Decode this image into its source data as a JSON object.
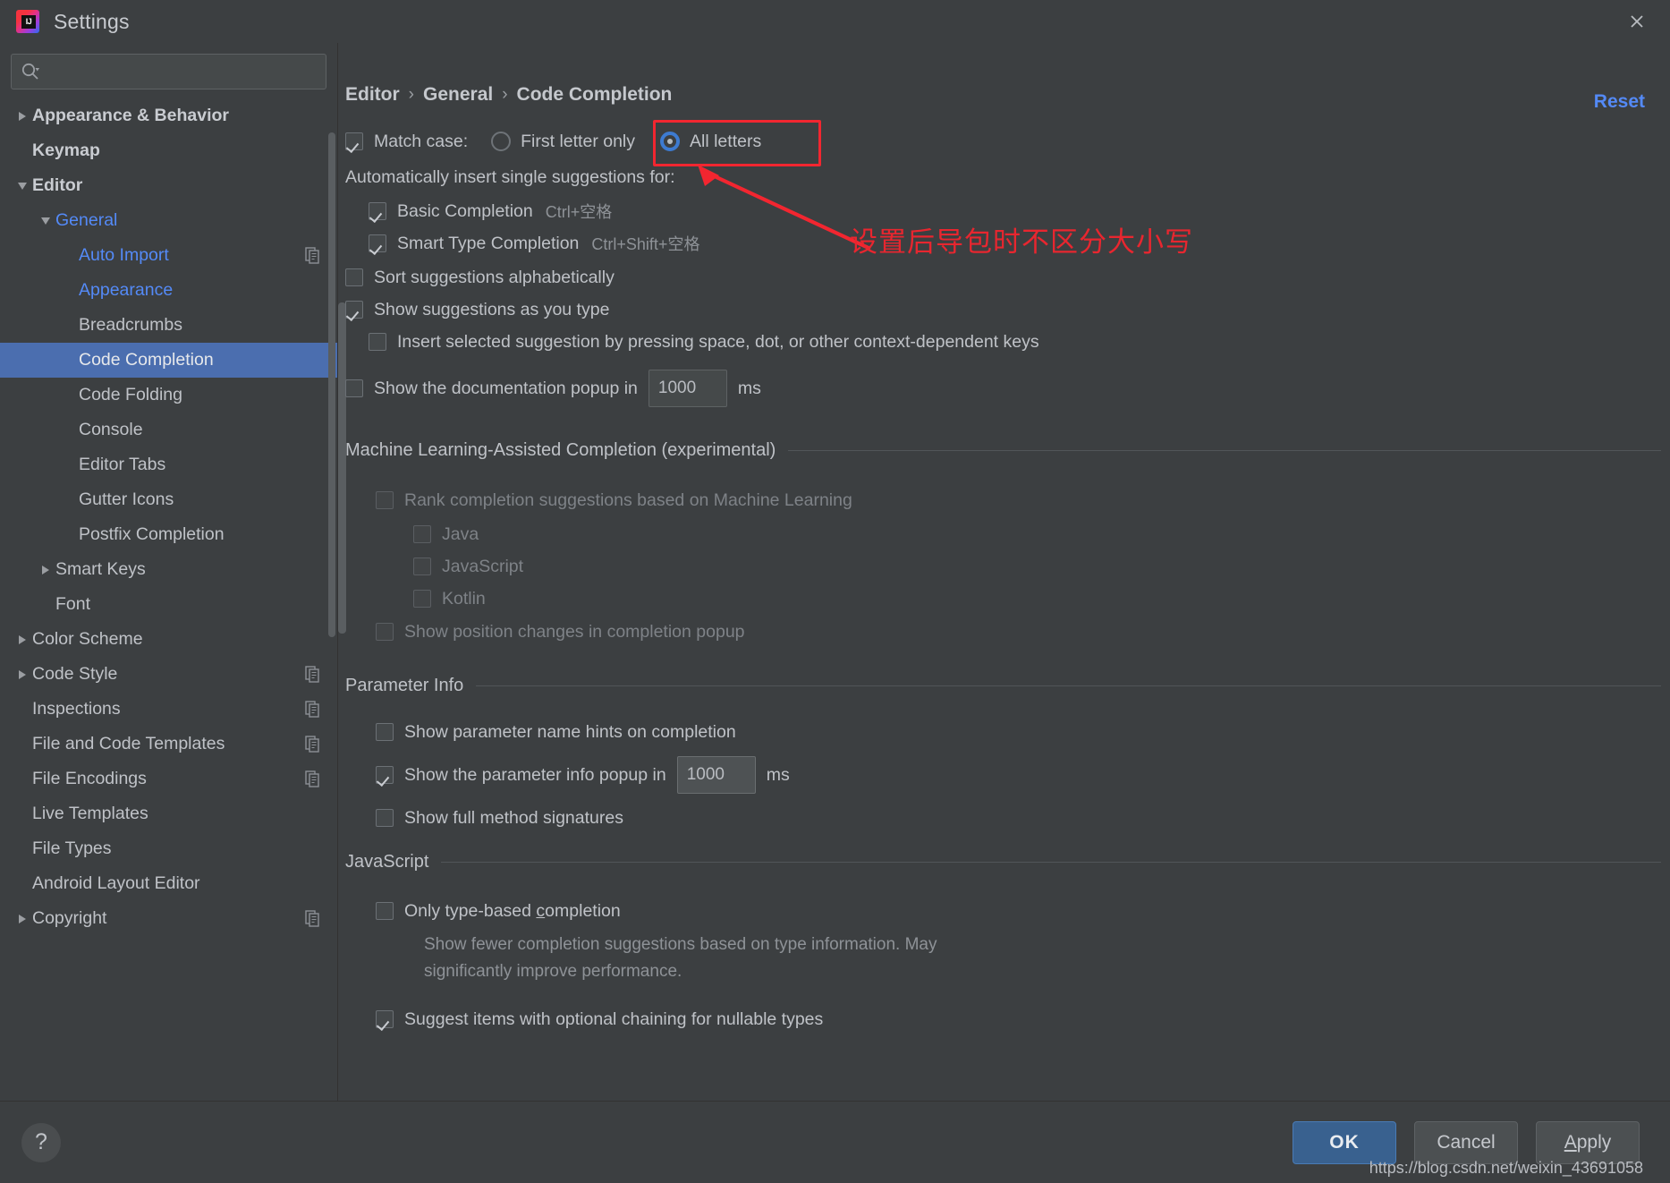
{
  "window": {
    "title": "Settings",
    "logo_icon": "intellij-idea-logo",
    "close_icon": "close-icon"
  },
  "search": {
    "value": "",
    "placeholder": "",
    "icon": "search-icon"
  },
  "sidebar": {
    "items": [
      {
        "label": "Appearance & Behavior",
        "indent": 0,
        "twisty": "collapsed",
        "bold": true,
        "color": "default",
        "badge": false,
        "selected": false
      },
      {
        "label": "Keymap",
        "indent": 0,
        "twisty": "none",
        "bold": true,
        "color": "default",
        "badge": false,
        "selected": false
      },
      {
        "label": "Editor",
        "indent": 0,
        "twisty": "expanded",
        "bold": true,
        "color": "default",
        "badge": false,
        "selected": false
      },
      {
        "label": "General",
        "indent": 1,
        "twisty": "expanded",
        "bold": false,
        "color": "blue",
        "badge": false,
        "selected": false
      },
      {
        "label": "Auto Import",
        "indent": 2,
        "twisty": "none",
        "bold": false,
        "color": "blue",
        "badge": true,
        "selected": false
      },
      {
        "label": "Appearance",
        "indent": 2,
        "twisty": "none",
        "bold": false,
        "color": "blue",
        "badge": false,
        "selected": false
      },
      {
        "label": "Breadcrumbs",
        "indent": 2,
        "twisty": "none",
        "bold": false,
        "color": "default",
        "badge": false,
        "selected": false
      },
      {
        "label": "Code Completion",
        "indent": 2,
        "twisty": "none",
        "bold": false,
        "color": "default",
        "badge": false,
        "selected": true
      },
      {
        "label": "Code Folding",
        "indent": 2,
        "twisty": "none",
        "bold": false,
        "color": "default",
        "badge": false,
        "selected": false
      },
      {
        "label": "Console",
        "indent": 2,
        "twisty": "none",
        "bold": false,
        "color": "default",
        "badge": false,
        "selected": false
      },
      {
        "label": "Editor Tabs",
        "indent": 2,
        "twisty": "none",
        "bold": false,
        "color": "default",
        "badge": false,
        "selected": false
      },
      {
        "label": "Gutter Icons",
        "indent": 2,
        "twisty": "none",
        "bold": false,
        "color": "default",
        "badge": false,
        "selected": false
      },
      {
        "label": "Postfix Completion",
        "indent": 2,
        "twisty": "none",
        "bold": false,
        "color": "default",
        "badge": false,
        "selected": false
      },
      {
        "label": "Smart Keys",
        "indent": 1,
        "twisty": "collapsed",
        "bold": false,
        "color": "default",
        "badge": false,
        "selected": false
      },
      {
        "label": "Font",
        "indent": 1,
        "twisty": "none",
        "bold": false,
        "color": "default",
        "badge": false,
        "selected": false
      },
      {
        "label": "Color Scheme",
        "indent": 0,
        "twisty": "collapsed",
        "bold": false,
        "color": "default",
        "badge": false,
        "selected": false
      },
      {
        "label": "Code Style",
        "indent": 0,
        "twisty": "collapsed",
        "bold": false,
        "color": "default",
        "badge": true,
        "selected": false
      },
      {
        "label": "Inspections",
        "indent": 0,
        "twisty": "none",
        "bold": false,
        "color": "default",
        "badge": true,
        "selected": false
      },
      {
        "label": "File and Code Templates",
        "indent": 0,
        "twisty": "none",
        "bold": false,
        "color": "default",
        "badge": true,
        "selected": false
      },
      {
        "label": "File Encodings",
        "indent": 0,
        "twisty": "none",
        "bold": false,
        "color": "default",
        "badge": true,
        "selected": false
      },
      {
        "label": "Live Templates",
        "indent": 0,
        "twisty": "none",
        "bold": false,
        "color": "default",
        "badge": false,
        "selected": false
      },
      {
        "label": "File Types",
        "indent": 0,
        "twisty": "none",
        "bold": false,
        "color": "default",
        "badge": false,
        "selected": false
      },
      {
        "label": "Android Layout Editor",
        "indent": 0,
        "twisty": "none",
        "bold": false,
        "color": "default",
        "badge": false,
        "selected": false
      },
      {
        "label": "Copyright",
        "indent": 0,
        "twisty": "collapsed",
        "bold": false,
        "color": "default",
        "badge": true,
        "selected": false
      }
    ]
  },
  "breadcrumb": {
    "items": [
      "Editor",
      "General",
      "Code Completion"
    ],
    "separator": "›"
  },
  "reset": {
    "label": "Reset"
  },
  "main": {
    "match_case": {
      "label": "Match case:",
      "checked": true,
      "options": [
        {
          "label": "First letter only",
          "selected": false
        },
        {
          "label": "All letters",
          "selected": true
        }
      ]
    },
    "auto_insert_header": "Automatically insert single suggestions for:",
    "auto_insert": [
      {
        "label": "Basic Completion",
        "shortcut": "Ctrl+空格",
        "checked": true
      },
      {
        "label": "Smart Type Completion",
        "shortcut": "Ctrl+Shift+空格",
        "checked": true
      }
    ],
    "sort_alphabetically": {
      "label": "Sort suggestions alphabetically",
      "checked": false
    },
    "show_as_you_type": {
      "label": "Show suggestions as you type",
      "checked": true
    },
    "insert_by_key": {
      "label": "Insert selected suggestion by pressing space, dot, or other context-dependent keys",
      "checked": false
    },
    "doc_popup": {
      "label": "Show the documentation popup in",
      "checked": false,
      "value": "1000",
      "unit": "ms"
    },
    "ml_section": {
      "title": "Machine Learning-Assisted Completion (experimental)",
      "rank": {
        "label": "Rank completion suggestions based on Machine Learning",
        "checked": false
      },
      "languages": [
        {
          "label": "Java",
          "checked": false
        },
        {
          "label": "JavaScript",
          "checked": false
        },
        {
          "label": "Kotlin",
          "checked": false
        }
      ],
      "position_changes": {
        "label": "Show position changes in completion popup",
        "checked": false
      }
    },
    "parameter_info": {
      "title": "Parameter Info",
      "name_hints": {
        "label": "Show parameter name hints on completion",
        "checked": false
      },
      "popup_delay": {
        "label": "Show the parameter info popup in",
        "checked": true,
        "value": "1000",
        "unit": "ms"
      },
      "full_signatures": {
        "label": "Show full method signatures",
        "checked": false
      }
    },
    "javascript": {
      "title": "JavaScript",
      "only_type_based": {
        "label_pre": "Only type-based ",
        "label_mnemonic": "c",
        "label_post": "ompletion",
        "checked": false
      },
      "description": "Show fewer completion suggestions based on type information. May significantly improve performance.",
      "optional_chaining": {
        "label": "Suggest items with optional chaining for nullable types",
        "checked": true
      }
    }
  },
  "annotation": {
    "text": "设置后导包时不区分大小写",
    "color": "#e8262f"
  },
  "footer": {
    "help_icon": "question-mark-icon",
    "help_label": "?",
    "ok_label": "OK",
    "cancel_label": "Cancel",
    "apply_label_pre": "",
    "apply_mnemonic": "A",
    "apply_label_post": "pply",
    "watermark": "https://blog.csdn.net/weixin_43691058"
  },
  "colors": {
    "accent": "#4b6eaf",
    "link": "#548af7",
    "annotation_red": "#e8262f",
    "panel_bg": "#3c3f41"
  }
}
